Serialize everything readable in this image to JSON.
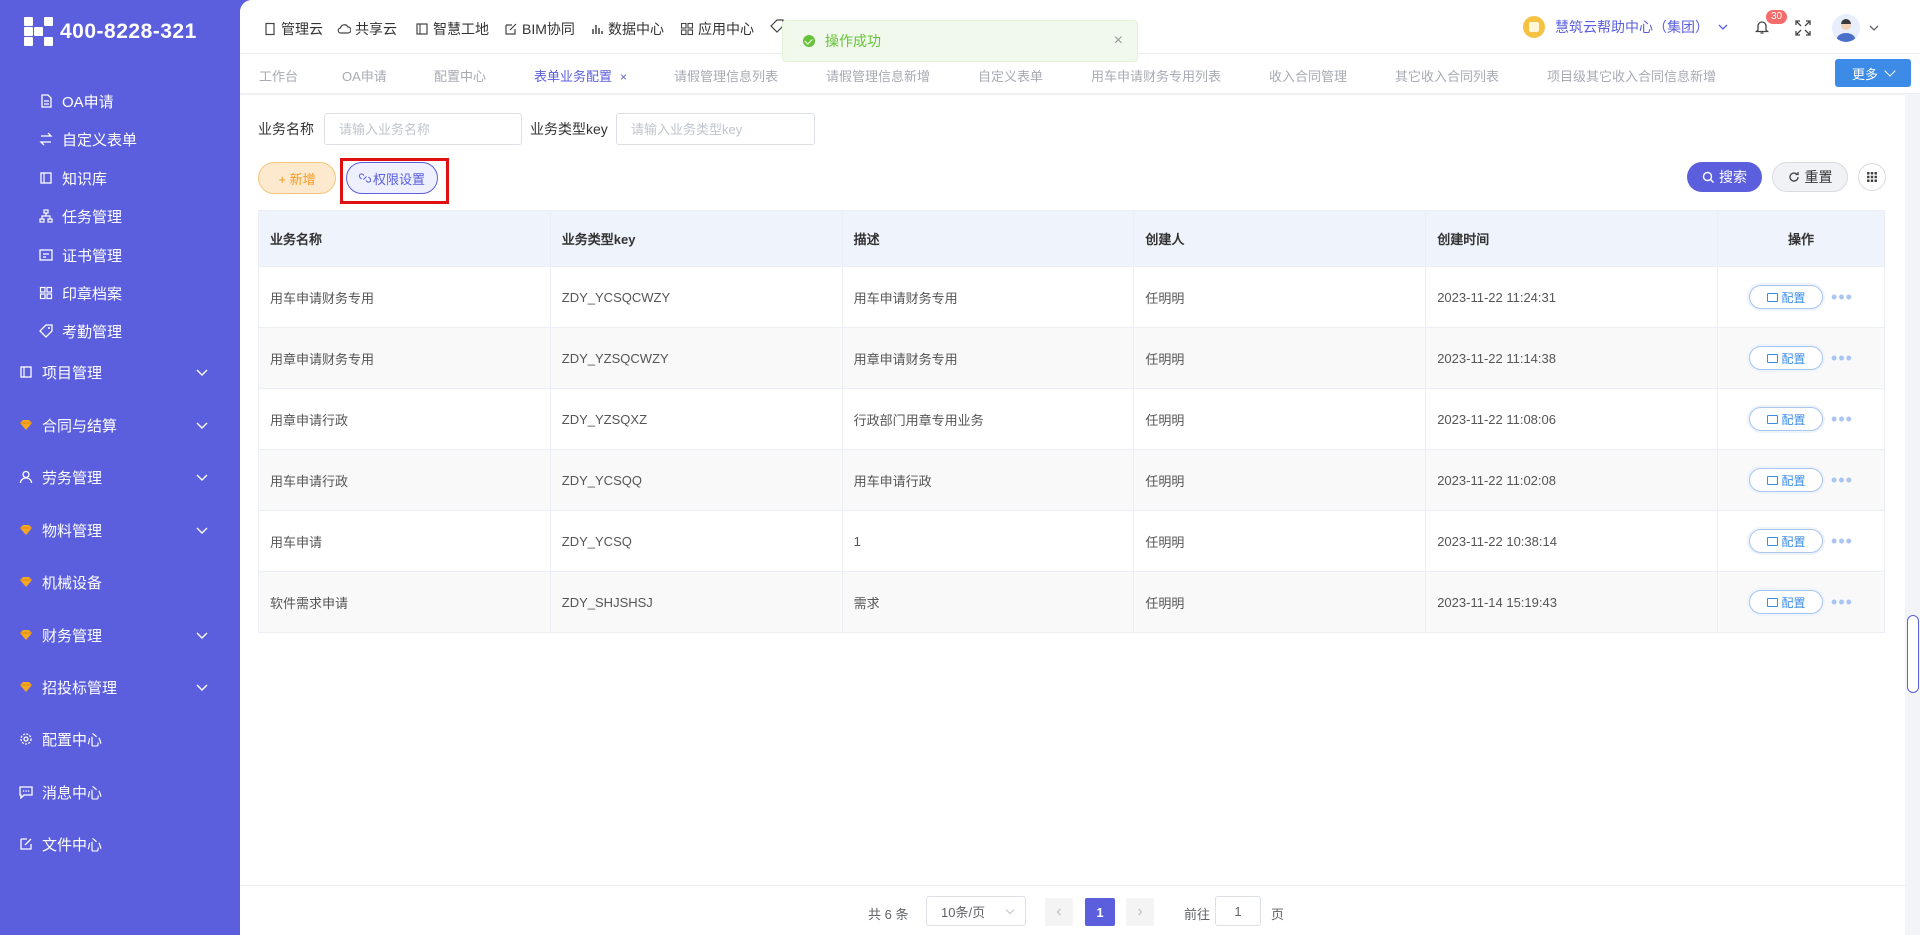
{
  "brand": {
    "phone": "400-8228-321"
  },
  "sidebar": {
    "items": [
      {
        "label": "OA申请",
        "icon": "document-icon"
      },
      {
        "label": "自定义表单",
        "icon": "exchange-icon"
      },
      {
        "label": "知识库",
        "icon": "book-icon"
      },
      {
        "label": "任务管理",
        "icon": "hierarchy-icon"
      },
      {
        "label": "证书管理",
        "icon": "certificate-icon"
      },
      {
        "label": "印章档案",
        "icon": "grid-icon"
      },
      {
        "label": "考勤管理",
        "icon": "tag-icon"
      },
      {
        "label": "项目管理",
        "icon": "book-icon"
      },
      {
        "label": "合同与结算",
        "icon": "gem-icon"
      },
      {
        "label": "劳务管理",
        "icon": "user-icon"
      },
      {
        "label": "物料管理",
        "icon": "gem-icon"
      },
      {
        "label": "机械设备",
        "icon": "gem-icon"
      },
      {
        "label": "财务管理",
        "icon": "gem-icon"
      },
      {
        "label": "招投标管理",
        "icon": "gem-icon"
      },
      {
        "label": "配置中心",
        "icon": "gear-icon"
      },
      {
        "label": "消息中心",
        "icon": "chat-icon"
      },
      {
        "label": "文件中心",
        "icon": "edit-icon"
      }
    ]
  },
  "topnav": {
    "items": [
      {
        "label": "管理云"
      },
      {
        "label": "共享云"
      },
      {
        "label": "智慧工地"
      },
      {
        "label": "BIM协同"
      },
      {
        "label": "数据中心"
      },
      {
        "label": "应用中心"
      }
    ],
    "help_label": "慧筑云帮助中心（集团）",
    "notification_count": "30"
  },
  "toast": {
    "message": "操作成功",
    "close": "×"
  },
  "tabs": [
    {
      "label": "工作台"
    },
    {
      "label": "OA申请"
    },
    {
      "label": "配置中心"
    },
    {
      "label": "表单业务配置",
      "active": true,
      "close": "×"
    },
    {
      "label": "请假管理信息列表"
    },
    {
      "label": "请假管理信息新增"
    },
    {
      "label": "自定义表单"
    },
    {
      "label": "用车申请财务专用列表"
    },
    {
      "label": "收入合同管理"
    },
    {
      "label": "其它收入合同列表"
    },
    {
      "label": "项目级其它收入合同信息新增"
    }
  ],
  "more_label": "更多",
  "filters": {
    "business_name_label": "业务名称",
    "business_name_placeholder": "请输入业务名称",
    "business_key_label": "业务类型key",
    "business_key_placeholder": "请输入业务类型key"
  },
  "toolbar": {
    "add_label": "+ 新增",
    "permission_label": "权限设置",
    "search_label": "搜索",
    "reset_label": "重置"
  },
  "table": {
    "columns": [
      "业务名称",
      "业务类型key",
      "描述",
      "创建人",
      "创建时间",
      "操作"
    ],
    "action_label": "配置",
    "more_actions": "•••",
    "rows": [
      {
        "name": "用车申请财务专用",
        "key": "ZDY_YCSQCWZY",
        "desc": "用车申请财务专用",
        "creator": "任明明",
        "time": "2023-11-22 11:24:31"
      },
      {
        "name": "用章申请财务专用",
        "key": "ZDY_YZSQCWZY",
        "desc": "用章申请财务专用",
        "creator": "任明明",
        "time": "2023-11-22 11:14:38"
      },
      {
        "name": "用章申请行政",
        "key": "ZDY_YZSQXZ",
        "desc": "行政部门用章专用业务",
        "creator": "任明明",
        "time": "2023-11-22 11:08:06"
      },
      {
        "name": "用车申请行政",
        "key": "ZDY_YCSQQ",
        "desc": "用车申请行政",
        "creator": "任明明",
        "time": "2023-11-22 11:02:08"
      },
      {
        "name": "用车申请",
        "key": "ZDY_YCSQ",
        "desc": "1",
        "creator": "任明明",
        "time": "2023-11-22 10:38:14"
      },
      {
        "name": "软件需求申请",
        "key": "ZDY_SHJSHSJ",
        "desc": "需求",
        "creator": "任明明",
        "time": "2023-11-14 15:19:43"
      }
    ]
  },
  "pagination": {
    "total_label": "共 6 条",
    "page_size_label": "10条/页",
    "current_page": "1",
    "goto_prefix": "前往",
    "goto_value": "1",
    "goto_suffix": "页"
  },
  "colors": {
    "primary": "#5b5fdd",
    "accent_blue": "#3c8ce7",
    "highlight_red": "#e01010",
    "success": "#67c23a"
  }
}
